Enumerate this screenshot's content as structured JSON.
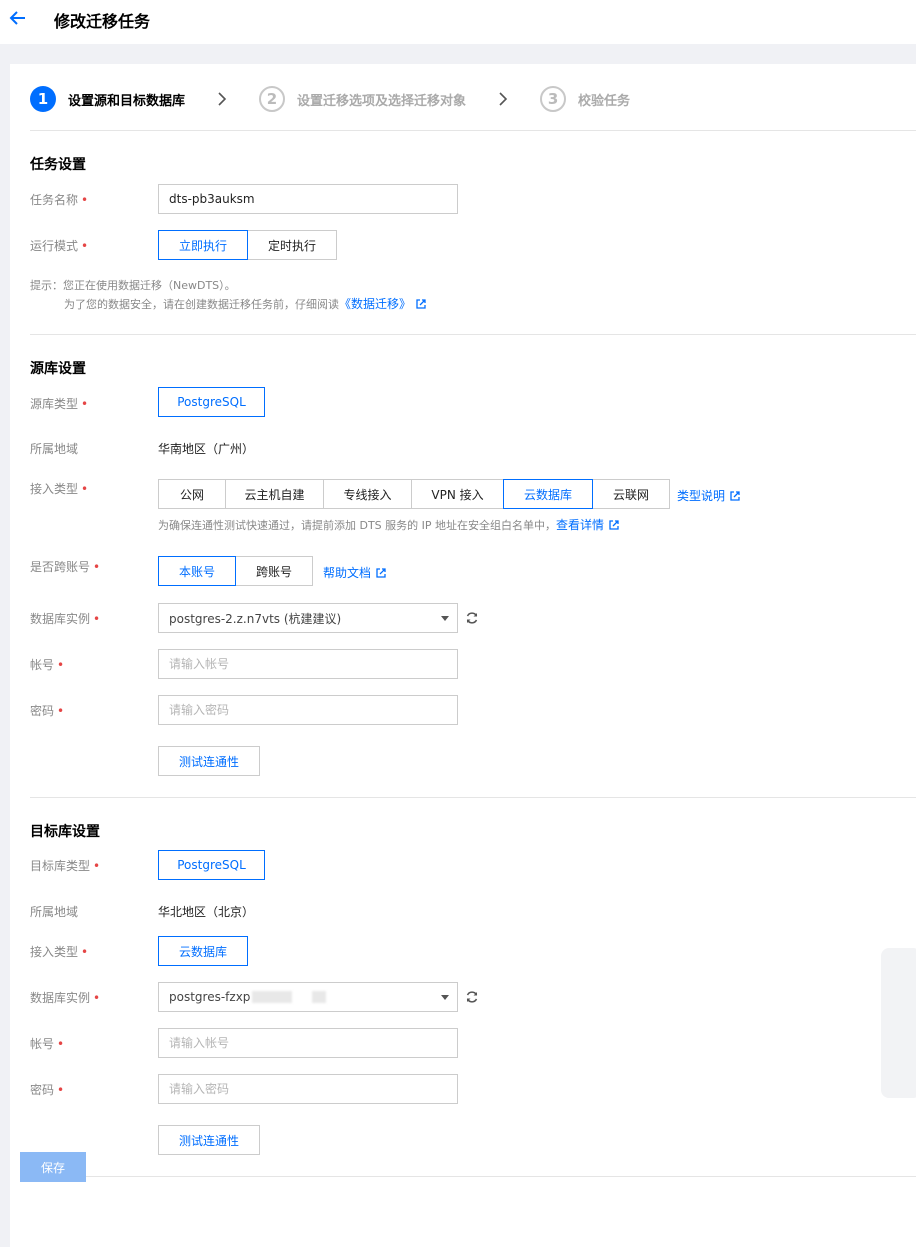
{
  "header": {
    "title": "修改迁移任务"
  },
  "steps": [
    {
      "num": "1",
      "label": "设置源和目标数据库"
    },
    {
      "num": "2",
      "label": "设置迁移选项及选择迁移对象"
    },
    {
      "num": "3",
      "label": "校验任务"
    }
  ],
  "task": {
    "section_title": "任务设置",
    "name_label": "任务名称",
    "name_value": "dts-pb3auksm",
    "mode_label": "运行模式",
    "mode_options": [
      "立即执行",
      "定时执行"
    ],
    "hint_line1": "提示：您正在使用数据迁移（NewDTS）。",
    "hint_line2_prefix": "为了您的数据安全，请在创建数据迁移任务前，仔细阅读",
    "hint_link": "《数据迁移》"
  },
  "source": {
    "section_title": "源库设置",
    "type_label": "源库类型",
    "type_value": "PostgreSQL",
    "region_label": "所属地域",
    "region_value": "华南地区（广州）",
    "access_label": "接入类型",
    "access_options": [
      "公网",
      "云主机自建",
      "专线接入",
      "VPN 接入",
      "云数据库",
      "云联网"
    ],
    "access_help_link": "类型说明",
    "access_hint_prefix": "为确保连通性测试快速通过，请提前添加 DTS 服务的 IP 地址在安全组白名单中，",
    "access_hint_link": "查看详情",
    "cross_label": "是否跨账号",
    "cross_options": [
      "本账号",
      "跨账号"
    ],
    "cross_help_link": "帮助文档",
    "instance_label": "数据库实例",
    "instance_value": "postgres-2.z.n7vts (杭建建议)",
    "account_label": "帐号",
    "account_placeholder": "请输入帐号",
    "password_label": "密码",
    "password_placeholder": "请输入密码",
    "test_button": "测试连通性"
  },
  "target": {
    "section_title": "目标库设置",
    "type_label": "目标库类型",
    "type_value": "PostgreSQL",
    "region_label": "所属地域",
    "region_value": "华北地区（北京）",
    "access_label": "接入类型",
    "access_value": "云数据库",
    "instance_label": "数据库实例",
    "instance_value": "postgres-fzxp",
    "account_label": "帐号",
    "account_placeholder": "请输入帐号",
    "password_label": "密码",
    "password_placeholder": "请输入密码",
    "test_button": "测试连通性"
  },
  "footer": {
    "save_button": "保存"
  },
  "colors": {
    "accent": "#006eff",
    "required": "#e54545",
    "disabled_button": "#8bb9f5"
  }
}
